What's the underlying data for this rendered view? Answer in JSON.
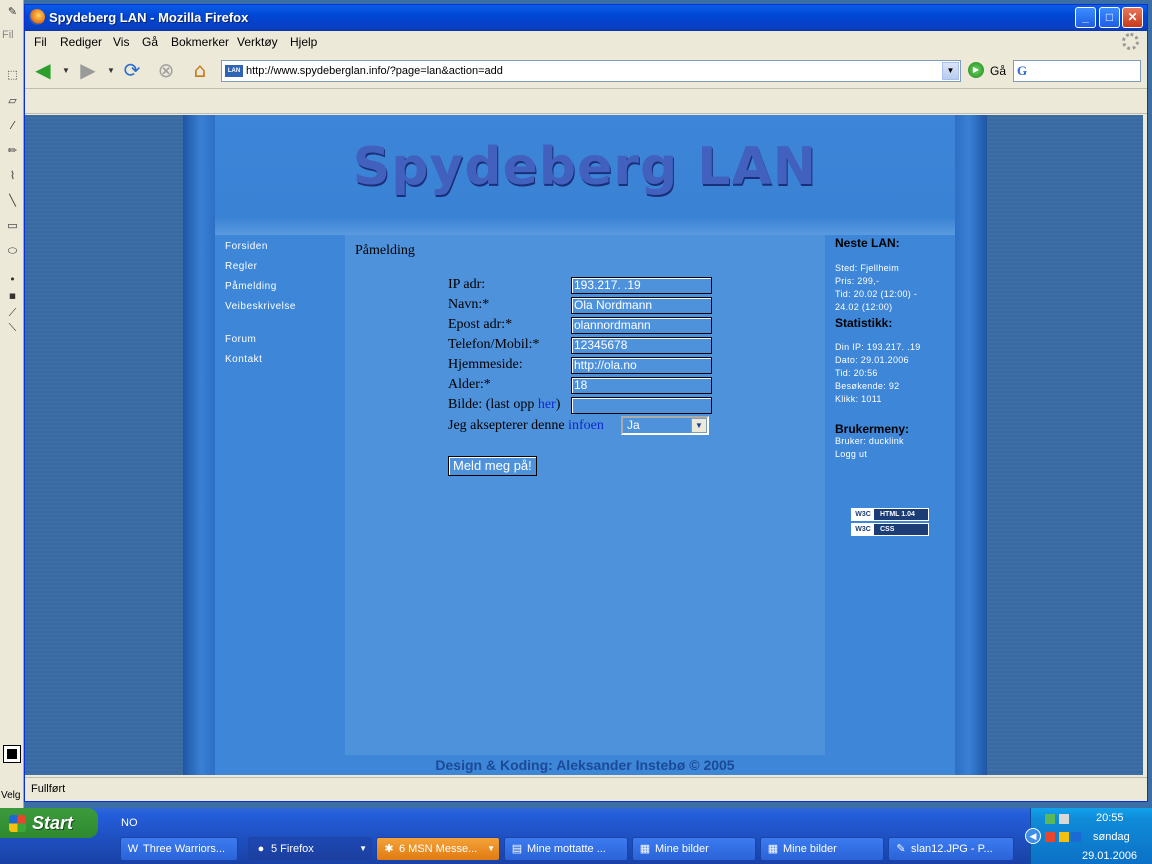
{
  "browser": {
    "title": "Spydeberg LAN - Mozilla Firefox",
    "menu": [
      "Fil",
      "Rediger",
      "Vis",
      "Gå",
      "Bokmerker",
      "Verktøy",
      "Hjelp"
    ],
    "url": "http://www.spydeberglan.info/?page=lan&action=add",
    "go_label": "Gå",
    "search_icon": "G",
    "status": "Fullført"
  },
  "paint": {
    "menu_label": "Fil",
    "status_label": "Velg"
  },
  "site": {
    "title": "Spydeberg LAN",
    "nav": [
      "Forsiden",
      "Regler",
      "Påmelding",
      "Veibeskrivelse",
      "Forum",
      "Kontakt"
    ],
    "footer": "Design & Koding: Aleksander Instebø © 2005"
  },
  "form": {
    "heading": "Påmelding",
    "fields": [
      {
        "label": "IP adr:",
        "value": "193.217.      .19"
      },
      {
        "label": "Navn:*",
        "value": "Ola Nordmann"
      },
      {
        "label": "Epost adr:*",
        "value": "olannordmann"
      },
      {
        "label": "Telefon/Mobil:*",
        "value": "12345678"
      },
      {
        "label": "Hjemmeside:",
        "value": "http://ola.no"
      },
      {
        "label": "Alder:*",
        "value": "18"
      }
    ],
    "picture_label": "Bilde: (last opp",
    "picture_link": "her",
    "picture_close": ")",
    "picture_value": "",
    "accept_label": "Jeg aksepterer denne",
    "accept_link": "infoen",
    "accept_value": "Ja",
    "submit": "Meld meg på!"
  },
  "sidebar": {
    "next_heading": "Neste LAN:",
    "next_lines": [
      "Sted: Fjellheim",
      "Pris: 299,-",
      "Tid: 20.02 (12:00) -",
      "24.02 (12:00)"
    ],
    "stats_heading": "Statistikk:",
    "stats_lines": [
      "Din IP: 193.217.      .19",
      "Dato: 29.01.2006",
      "Tid: 20:56",
      "Besøkende: 92",
      "Klikk: 1011"
    ],
    "user_heading": "Brukermeny:",
    "user_lines": [
      "Bruker: ducklink",
      "Logg ut"
    ],
    "badges": [
      {
        "logo": "W3C",
        "text": "HTML 1.04"
      },
      {
        "logo": "W3C",
        "text": "CSS"
      }
    ]
  },
  "taskbar": {
    "start": "Start",
    "language": "NO",
    "tasks": [
      {
        "label": "Three Warriors...",
        "icon": "W"
      },
      {
        "label": "5 Firefox",
        "icon": "●"
      },
      {
        "label": "6 MSN Messe...",
        "icon": "✱"
      },
      {
        "label": "Mine mottatte ...",
        "icon": "▤"
      },
      {
        "label": "Mine bilder",
        "icon": "▦"
      },
      {
        "label": "Mine bilder",
        "icon": "▦"
      },
      {
        "label": "slan12.JPG - P...",
        "icon": "✎"
      }
    ],
    "clock": "20:55",
    "day": "søndag",
    "date": "29.01.2006"
  }
}
